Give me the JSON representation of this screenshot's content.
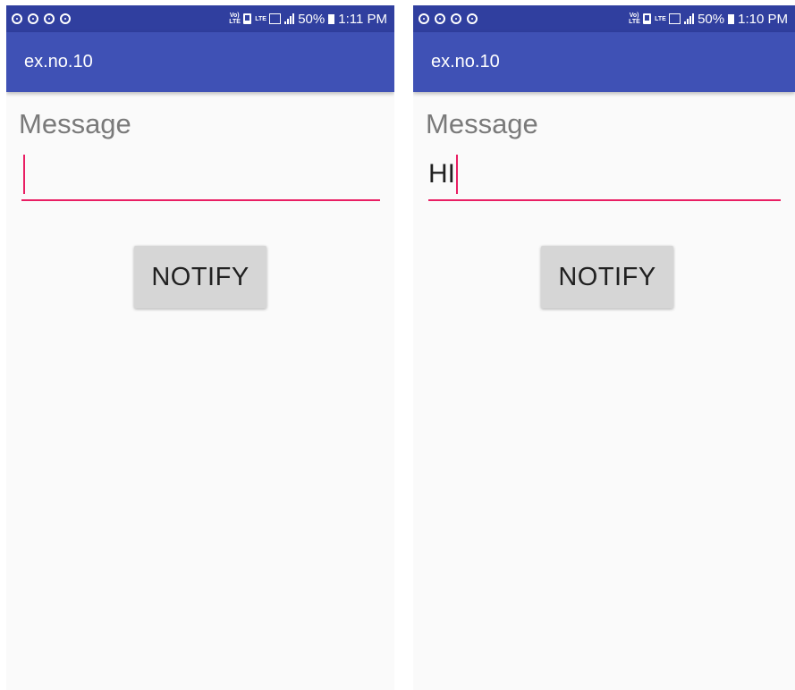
{
  "screens": [
    {
      "status": {
        "battery": "50%",
        "time": "1:11 PM",
        "volte": "Vo) LTE",
        "lte": "LTE"
      },
      "app_title": "ex.no.10",
      "message_label": "Message",
      "message_value": "",
      "button_label": "NOTIFY"
    },
    {
      "status": {
        "battery": "50%",
        "time": "1:10 PM",
        "volte": "Vo) LTE",
        "lte": "LTE"
      },
      "app_title": "ex.no.10",
      "message_label": "Message",
      "message_value": "HI",
      "button_label": "NOTIFY"
    }
  ],
  "colors": {
    "status_bar": "#303f9f",
    "app_bar": "#3f51b5",
    "accent": "#e91e63",
    "background": "#fafafa",
    "button": "#d6d6d6"
  }
}
